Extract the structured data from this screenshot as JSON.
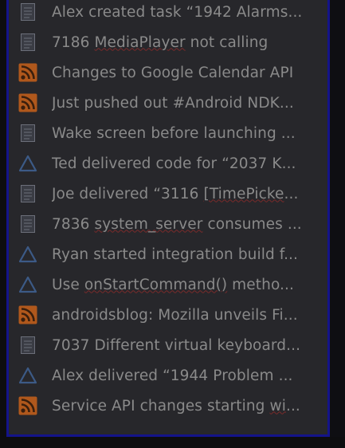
{
  "feed": {
    "items": [
      {
        "icon": "document-icon",
        "parts": [
          {
            "t": "Alex created task “1942 Alarms..."
          }
        ]
      },
      {
        "icon": "document-icon",
        "parts": [
          {
            "t": "7186 "
          },
          {
            "t": "MediaPlayer",
            "u": true
          },
          {
            "t": " not calling"
          }
        ]
      },
      {
        "icon": "rss-icon",
        "parts": [
          {
            "t": "Changes to Google Calendar API"
          }
        ]
      },
      {
        "icon": "rss-icon",
        "parts": [
          {
            "t": "Just pushed out #Android NDK..."
          }
        ]
      },
      {
        "icon": "document-icon",
        "parts": [
          {
            "t": "Wake screen before launching ..."
          }
        ]
      },
      {
        "icon": "triangle-icon",
        "parts": [
          {
            "t": "Ted delivered code for “2037 K..."
          }
        ]
      },
      {
        "icon": "document-icon",
        "parts": [
          {
            "t": "Joe delivered  “3116 "
          },
          {
            "t": "[TimePicke",
            "u": true
          },
          {
            "t": "..."
          }
        ]
      },
      {
        "icon": "document-icon",
        "parts": [
          {
            "t": "7836 "
          },
          {
            "t": "system_server",
            "u": true
          },
          {
            "t": " consumes ..."
          }
        ]
      },
      {
        "icon": "triangle-icon",
        "parts": [
          {
            "t": "Ryan started integration build f..."
          }
        ]
      },
      {
        "icon": "triangle-icon",
        "parts": [
          {
            "t": "Use "
          },
          {
            "t": "onStartCommand()",
            "u": true
          },
          {
            "t": " metho..."
          }
        ]
      },
      {
        "icon": "rss-icon",
        "parts": [
          {
            "t": "androidsblog: Mozilla unveils Fi..."
          }
        ]
      },
      {
        "icon": "document-icon",
        "parts": [
          {
            "t": "7037 Different virtual keyboard..."
          }
        ]
      },
      {
        "icon": "triangle-icon",
        "parts": [
          {
            "t": "Alex delivered “1944 Problem ..."
          }
        ]
      },
      {
        "icon": "rss-icon",
        "parts": [
          {
            "t": "Service API changes starting "
          },
          {
            "t": "wi",
            "u": true
          },
          {
            "t": "..."
          }
        ]
      }
    ]
  },
  "colors": {
    "text": "#8a8a8a",
    "frame_border": "#14148a",
    "background": "#27272b",
    "rss_orange": "#b0581c",
    "triangle_blue": "#3c5a86",
    "document_gray": "#6c6f7a"
  }
}
